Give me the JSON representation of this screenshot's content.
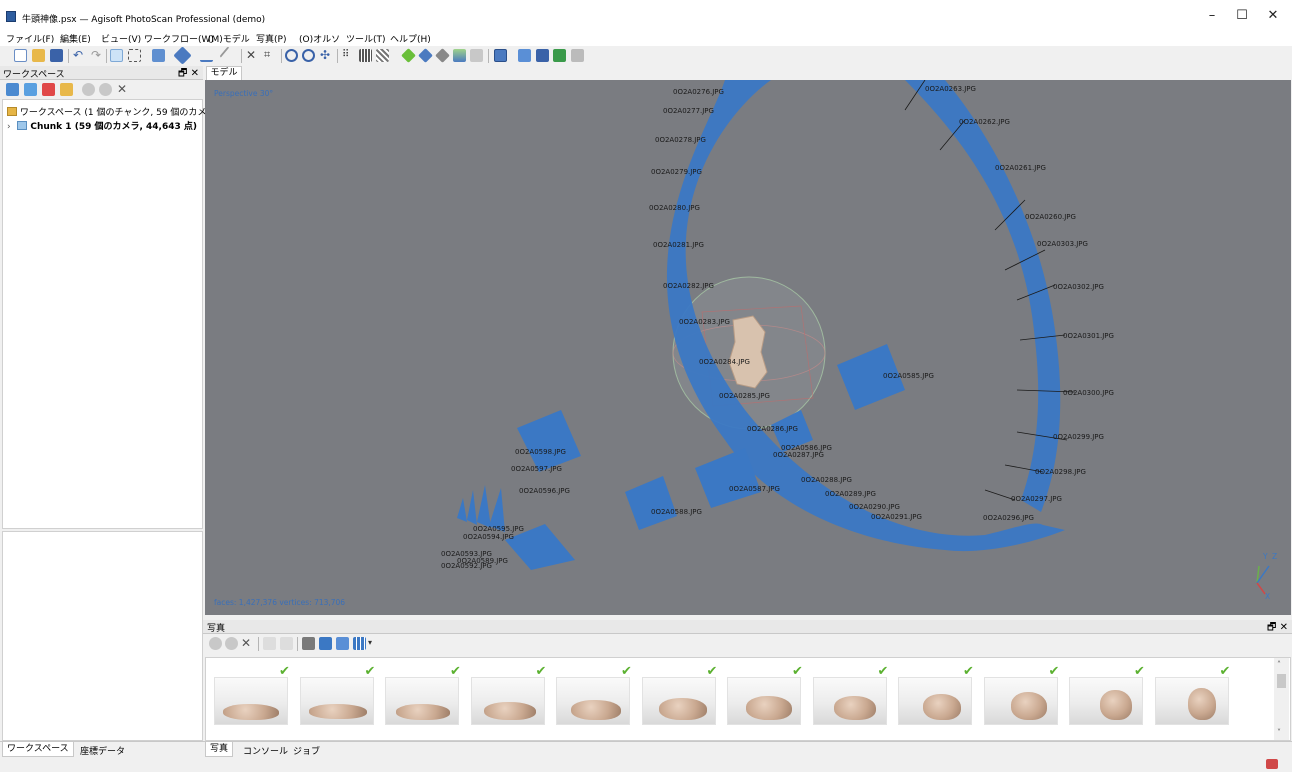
{
  "window": {
    "title": "牛頭神像.psx — Agisoft PhotoScan Professional (demo)",
    "minimize": "–",
    "maximize": "☐",
    "close": "✕"
  },
  "menu": [
    "ファイル(F)",
    "編集(E)",
    "ビュー(V)",
    "ワークフロー(W)",
    "(M)モデル",
    "写真(P)",
    "(O)オルソ",
    "ツール(T)",
    "ヘルプ(H)"
  ],
  "workspace": {
    "title": "ワークスペース",
    "panel_controls": "🗗 ✕",
    "root_label": "ワークスペース (1 個のチャンク, 59 個のカメラ)",
    "chunk_label": "Chunk 1 (59 個のカメラ, 44,643 点)",
    "tabs": [
      "ワークスペース",
      "座標データ"
    ]
  },
  "model": {
    "tab": "モデル",
    "projection": "Perspective 30°",
    "stats": "faces: 1,427,376 vertices: 713,706",
    "axis_labels": [
      "Y",
      "Z",
      "X"
    ],
    "camera_labels": [
      "0O2A0276.JPG",
      "0O2A0277.JPG",
      "0O2A0278.JPG",
      "0O2A0279.JPG",
      "0O2A0280.JPG",
      "0O2A0281.JPG",
      "0O2A0282.JPG",
      "0O2A0283.JPG",
      "0O2A0284.JPG",
      "0O2A0285.JPG",
      "0O2A0286.JPG",
      "0O2A0263.JPG",
      "0O2A0262.JPG",
      "0O2A0261.JPG",
      "0O2A0260.JPG",
      "0O2A0303.JPG",
      "0O2A0302.JPG",
      "0O2A0301.JPG",
      "0O2A0300.JPG",
      "0O2A0299.JPG",
      "0O2A0298.JPG",
      "0O2A0297.JPG",
      "0O2A0296.JPG",
      "0O2A0585.JPG",
      "0O2A0586.JPG",
      "0O2A0287.JPG",
      "0O2A0288.JPG",
      "0O2A0289.JPG",
      "0O2A0290.JPG",
      "0O2A0291.JPG",
      "0O2A0598.JPG",
      "0O2A0597.JPG",
      "0O2A0596.JPG",
      "0O2A0588.JPG",
      "0O2A0587.JPG",
      "0O2A0595.JPG",
      "0O2A0594.JPG",
      "0O2A0593.JPG",
      "0O2A0589.JPG",
      "0O2A0592.JPG"
    ]
  },
  "photos": {
    "title": "写真",
    "panel_controls": "🗗 ✕",
    "count": 12,
    "check_glyph": "✔",
    "tabs": [
      "写真",
      "コンソール",
      "ジョブ"
    ]
  },
  "colors": {
    "camera_blue": "#3b78c4",
    "viewport_bg": "#7a7c81",
    "check_green": "#5bb130"
  }
}
